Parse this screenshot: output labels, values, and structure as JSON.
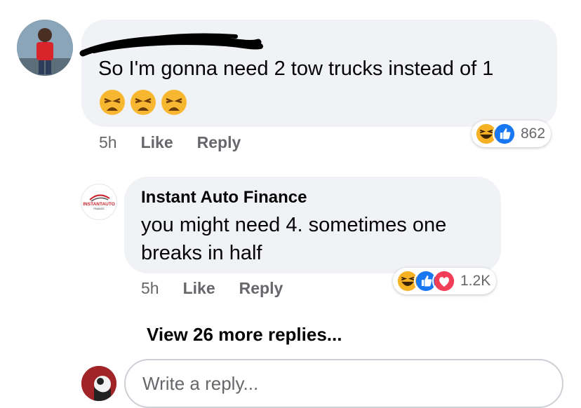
{
  "comment": {
    "author": "",
    "text": "So I'm gonna need 2 tow trucks instead of 1",
    "emojis": [
      "weary-face",
      "weary-face",
      "weary-face"
    ],
    "time": "5h",
    "like_label": "Like",
    "reply_label": "Reply",
    "reactions": {
      "icons": [
        "laughing-face",
        "like-thumb"
      ],
      "count": "862"
    }
  },
  "reply": {
    "author": "Instant Auto Finance",
    "avatar_text": "INSTANTAUTO",
    "avatar_subtext": "FINANCE",
    "text_line1": "you might need 4. sometimes one",
    "text_line2": "breaks in half",
    "time": "5h",
    "like_label": "Like",
    "reply_label": "Reply",
    "reactions": {
      "icons": [
        "laughing-face",
        "like-thumb",
        "love-heart"
      ],
      "count": "1.2K"
    }
  },
  "view_more": "View 26 more replies...",
  "composer": {
    "placeholder": "Write a reply..."
  },
  "colors": {
    "like": "#1877f2",
    "love": "#f33e58",
    "haha": "#f7b125",
    "bubble": "#f0f2f5",
    "meta": "#65676b"
  }
}
